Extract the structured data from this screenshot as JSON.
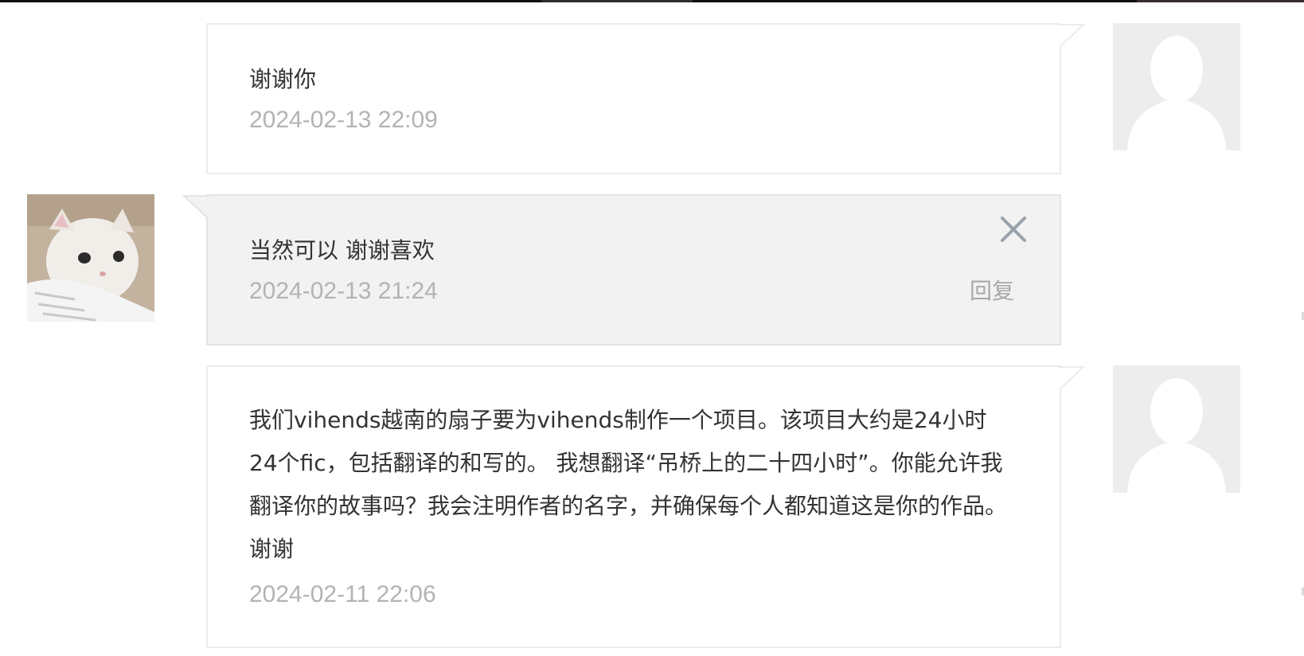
{
  "comments": [
    {
      "text": "谢谢你",
      "time": "2024-02-13 22:09",
      "author_avatar": "default-avatar"
    },
    {
      "text": "当然可以 谢谢喜欢",
      "time": "2024-02-13 21:24",
      "reply_label": "回复",
      "close_icon": "close-icon",
      "author_avatar": "cat-avatar"
    },
    {
      "text": "我们vihends越南的扇子要为vihends制作一个项目。该项目大约是24小时24个fic，包括翻译的和写的。 我想翻译“吊桥上的二十四小时”。你能允许我翻译你的故事吗？我会注明作者的名字，并确保每个人都知道这是你的作品。谢谢",
      "time": "2024-02-11 22:06",
      "author_avatar": "default-avatar"
    }
  ],
  "colors": {
    "bubble_border": "#ececec",
    "self_bubble_bg": "#f2f2f2",
    "text": "#333333",
    "timestamp": "#b3b3b3",
    "avatar_placeholder": "#ededed",
    "silhouette": "#ffffff"
  }
}
